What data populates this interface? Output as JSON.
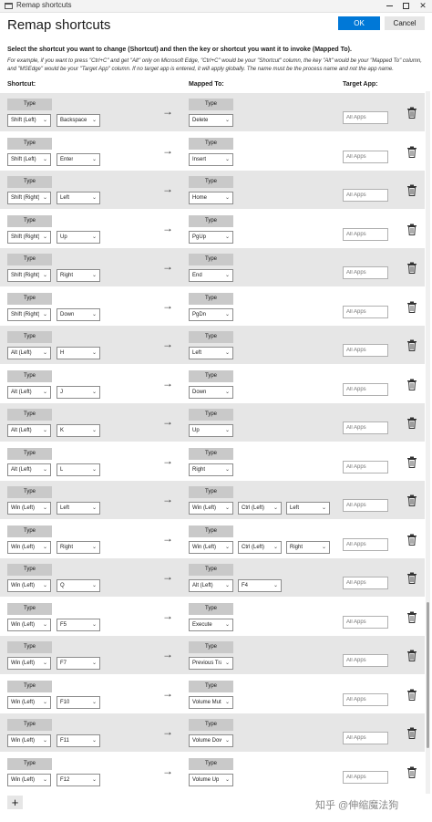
{
  "window": {
    "title": "Remap shortcuts",
    "controls": {
      "minimize": "minimize-icon",
      "maximize": "maximize-icon",
      "close": "✕"
    }
  },
  "dialog": {
    "title": "Remap shortcuts",
    "ok_label": "OK",
    "cancel_label": "Cancel",
    "instruction": "Select the shortcut you want to change (Shortcut) and then the key or shortcut you want it to invoke (Mapped To).",
    "example": "For example, if you want to press \"Ctrl+C\" and get \"Alt\" only on Microsoft Edge, \"Ctrl+C\" would be your \"Shortcut\" column, the key \"Alt\" would be your \"Mapped To\" column, and \"MSEdge\" would be your \"Target App\" column. If no target app is entered, it will apply globally. The name must be the process name and not the app name."
  },
  "columns": {
    "shortcut": "Shortcut:",
    "mapped_to": "Mapped To:",
    "target_app": "Target App:"
  },
  "type_label": "Type",
  "arrow_glyph": "→",
  "add_label": "+",
  "rows": [
    {
      "shortcut": [
        "Shift (Left)",
        "Backspace"
      ],
      "mapped": [
        "Delete"
      ],
      "target_app_placeholder": "All Apps"
    },
    {
      "shortcut": [
        "Shift (Left)",
        "Enter"
      ],
      "mapped": [
        "Insert"
      ],
      "target_app_placeholder": "All Apps"
    },
    {
      "shortcut": [
        "Shift (Right)",
        "Left"
      ],
      "mapped": [
        "Home"
      ],
      "target_app_placeholder": "All Apps"
    },
    {
      "shortcut": [
        "Shift (Right)",
        "Up"
      ],
      "mapped": [
        "PgUp"
      ],
      "target_app_placeholder": "All Apps"
    },
    {
      "shortcut": [
        "Shift (Right)",
        "Right"
      ],
      "mapped": [
        "End"
      ],
      "target_app_placeholder": "All Apps"
    },
    {
      "shortcut": [
        "Shift (Right)",
        "Down"
      ],
      "mapped": [
        "PgDn"
      ],
      "target_app_placeholder": "All Apps"
    },
    {
      "shortcut": [
        "Alt (Left)",
        "H"
      ],
      "mapped": [
        "Left"
      ],
      "target_app_placeholder": "All Apps"
    },
    {
      "shortcut": [
        "Alt (Left)",
        "J"
      ],
      "mapped": [
        "Down"
      ],
      "target_app_placeholder": "All Apps"
    },
    {
      "shortcut": [
        "Alt (Left)",
        "K"
      ],
      "mapped": [
        "Up"
      ],
      "target_app_placeholder": "All Apps"
    },
    {
      "shortcut": [
        "Alt (Left)",
        "L"
      ],
      "mapped": [
        "Right"
      ],
      "target_app_placeholder": "All Apps"
    },
    {
      "shortcut": [
        "Win (Left)",
        "Left"
      ],
      "mapped": [
        "Win (Left)",
        "Ctrl (Left)",
        "Left"
      ],
      "target_app_placeholder": "All Apps"
    },
    {
      "shortcut": [
        "Win (Left)",
        "Right"
      ],
      "mapped": [
        "Win (Left)",
        "Ctrl (Left)",
        "Right"
      ],
      "target_app_placeholder": "All Apps"
    },
    {
      "shortcut": [
        "Win (Left)",
        "Q"
      ],
      "mapped": [
        "Alt (Left)",
        "F4"
      ],
      "target_app_placeholder": "All Apps"
    },
    {
      "shortcut": [
        "Win (Left)",
        "F5"
      ],
      "mapped": [
        "Execute"
      ],
      "target_app_placeholder": "All Apps"
    },
    {
      "shortcut": [
        "Win (Left)",
        "F7"
      ],
      "mapped": [
        "Previous Track"
      ],
      "target_app_placeholder": "All Apps"
    },
    {
      "shortcut": [
        "Win (Left)",
        "F10"
      ],
      "mapped": [
        "Volume Mute"
      ],
      "target_app_placeholder": "All Apps"
    },
    {
      "shortcut": [
        "Win (Left)",
        "F11"
      ],
      "mapped": [
        "Volume Down"
      ],
      "target_app_placeholder": "All Apps"
    },
    {
      "shortcut": [
        "Win (Left)",
        "F12"
      ],
      "mapped": [
        "Volume Up"
      ],
      "target_app_placeholder": "All Apps"
    }
  ],
  "watermark": "知乎 @伸缩魔法狗",
  "colors": {
    "accent": "#0078d7",
    "row_shaded": "#e6e6e6",
    "type_button": "#c9c9c9"
  }
}
